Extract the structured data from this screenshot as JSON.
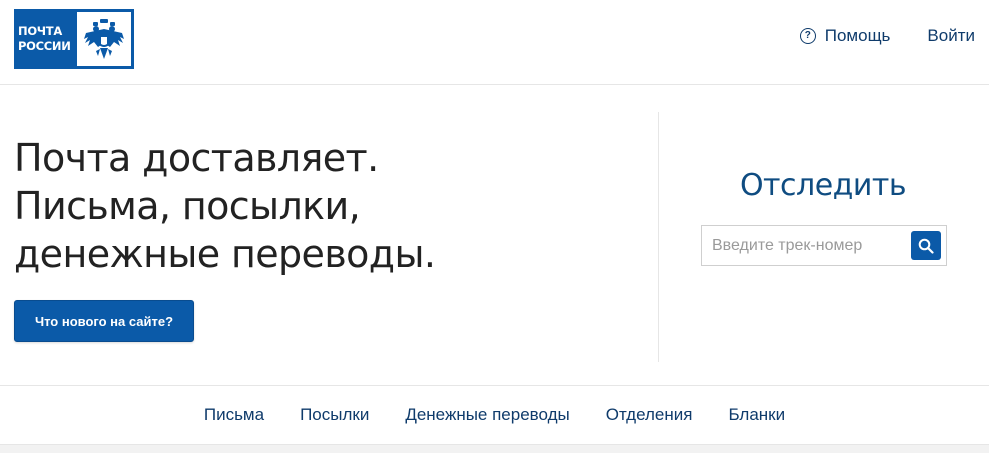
{
  "header": {
    "logo": {
      "line1": "ПОЧТА",
      "line2": "РОССИИ",
      "brand_color": "#0b5aa8",
      "emblem_icon": "double-headed-eagle-icon"
    },
    "help_icon": "question-circle-icon",
    "help_label": "Помощь",
    "login_label": "Войти"
  },
  "hero": {
    "headline": [
      "Почта доставляет.",
      "Письма, посылки,",
      "денежные переводы."
    ],
    "news_button_label": "Что нового на сайте?"
  },
  "tracking": {
    "title": "Отследить",
    "input_placeholder": "Введите трек-номер",
    "input_value": "",
    "search_icon": "search-icon"
  },
  "nav": {
    "items": [
      "Письма",
      "Посылки",
      "Денежные переводы",
      "Отделения",
      "Бланки"
    ]
  },
  "colors": {
    "accent": "#0b5aa8",
    "link": "#0f3b6b",
    "title": "#0f4c81",
    "text": "#222222"
  }
}
